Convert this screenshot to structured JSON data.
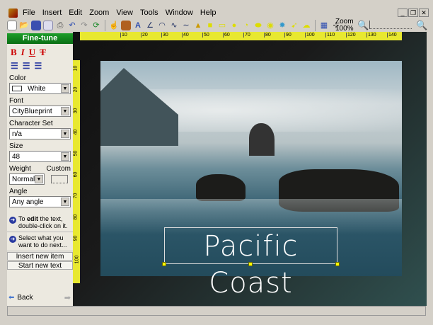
{
  "menu": [
    "File",
    "Insert",
    "Edit",
    "Zoom",
    "View",
    "Tools",
    "Window",
    "Help"
  ],
  "window_buttons": [
    "_",
    "❐",
    "✕"
  ],
  "toolbar": {
    "zoom_label": "Zoom",
    "zoom_value": "100%"
  },
  "ruler_top": [
    "10",
    "20",
    "30",
    "40",
    "50",
    "60",
    "70",
    "80",
    "90",
    "100",
    "110",
    "120",
    "130",
    "140"
  ],
  "ruler_left": [
    "10",
    "20",
    "30",
    "40",
    "50",
    "60",
    "70",
    "80",
    "90",
    "100"
  ],
  "panel": {
    "title": "Fine-tune",
    "format": [
      "B",
      "I",
      "U",
      "T"
    ],
    "color_label": "Color",
    "color_value": "White",
    "font_label": "Font",
    "font_value": "CityBlueprint",
    "charset_label": "Character Set",
    "charset_value": "n/a",
    "size_label": "Size",
    "size_value": "48",
    "weight_label": "Weight",
    "weight_value": "Normal",
    "custom_label": "Custom",
    "angle_label": "Angle",
    "angle_value": "Any angle",
    "hint1_pre": "To ",
    "hint1_bold": "edit",
    "hint1_post": " the text, double-click on it.",
    "hint2": "Select what you want to do next...",
    "insert_btn": "Insert new item",
    "start_btn": "Start new text",
    "back": "Back"
  },
  "canvas": {
    "text": "Pacific Coast"
  }
}
